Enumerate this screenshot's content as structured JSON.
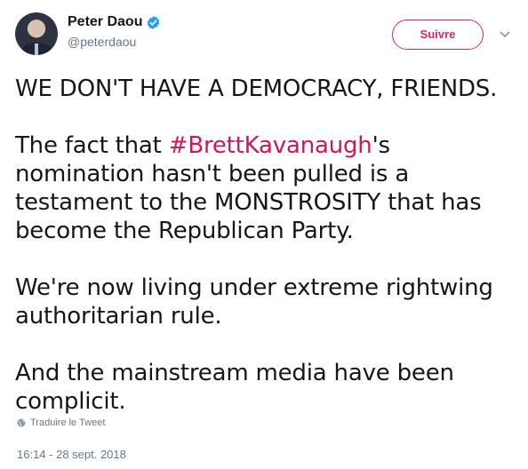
{
  "author": {
    "display_name": "Peter Daou",
    "handle": "@peterdaou",
    "verified": true
  },
  "follow_button": {
    "label": "Suivre",
    "color": "#e0245e"
  },
  "tweet": {
    "line1": "WE DON'T HAVE A DEMOCRACY, FRIENDS.",
    "para2_prefix": "The fact that ",
    "hashtag": "#BrettKavanaugh",
    "para2_suffix": "'s nomination hasn't been pulled is a testament to the MONSTROSITY that has become the Republican Party.",
    "para3": "We're now living under extreme rightwing authoritarian rule.",
    "para4": "And the mainstream media have been complicit."
  },
  "translate_label": "Traduire le Tweet",
  "timestamp": "16:14 - 28 sept. 2018",
  "colors": {
    "hashtag": "#d0155c",
    "secondary_text": "#657786",
    "verified": "#1da1f2"
  },
  "icons": [
    "verified-icon",
    "chevron-down-icon",
    "globe-icon"
  ]
}
